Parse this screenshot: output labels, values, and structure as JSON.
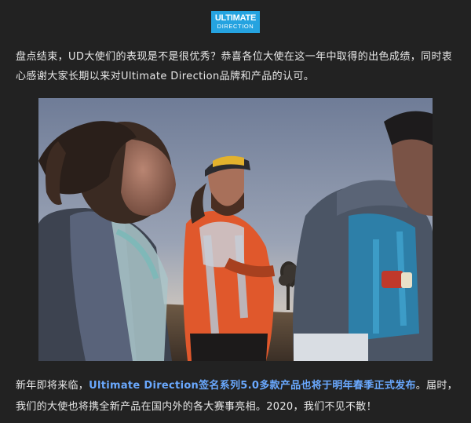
{
  "logo": {
    "line1": "ULTIMATE",
    "line2": "DIRECTION",
    "bg_color": "#25a3e0"
  },
  "intro_paragraph": "盘点结束，UD大使们的表现是不是很优秀？恭喜各位大使在这一年中取得的出色成绩，同时衷心感谢大家长期以来对Ultimate Direction品牌和产品的认可。",
  "photo": {
    "alt_subjects": [
      "runner-woman-left",
      "runner-man-center-orange-jacket",
      "runner-man-right-blue-vest"
    ]
  },
  "outro_paragraph": {
    "prefix": "新年即将来临，",
    "highlight": "Ultimate Direction签名系列5.0多款产品也将于明年春季正式发布",
    "suffix": "。届时，我们的大使也将携全新产品在国内外的各大赛事亮相。2020，我们不见不散！",
    "highlight_color": "#6aa9ff"
  },
  "colors": {
    "background": "#222222",
    "text": "#e8e8e8"
  }
}
